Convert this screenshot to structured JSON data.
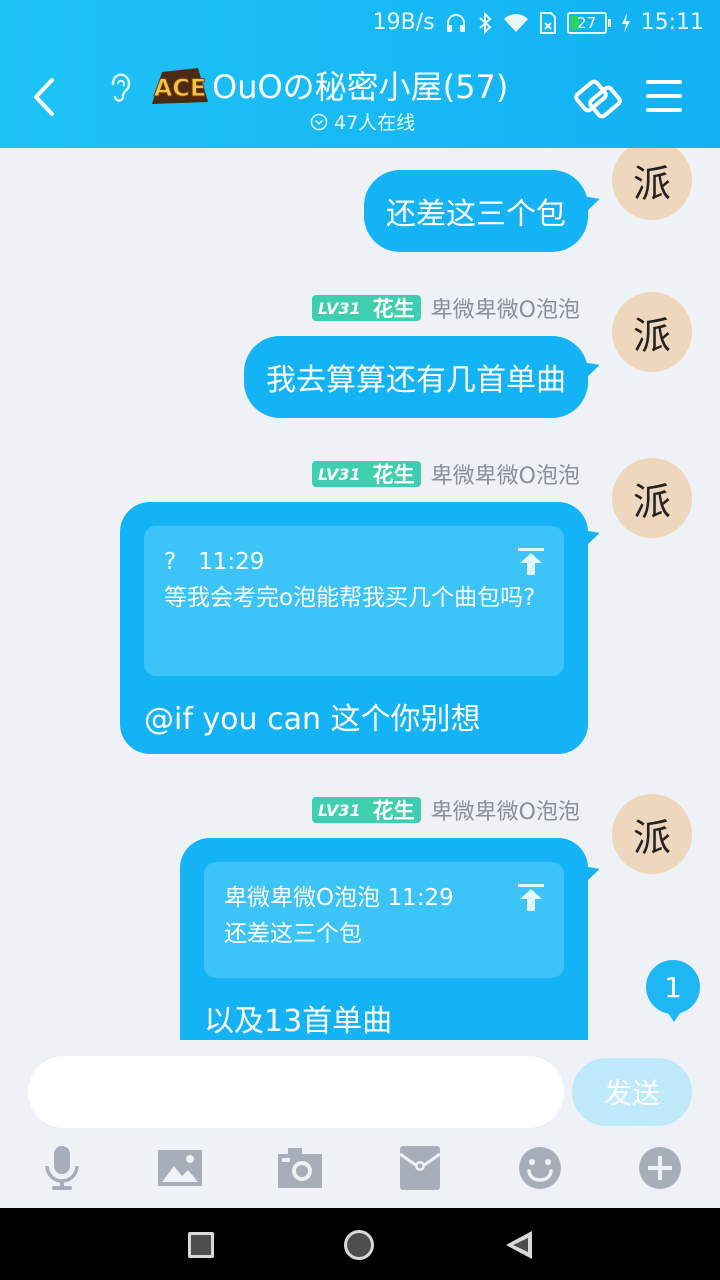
{
  "status_bar": {
    "speed": "19B/s",
    "battery": "27",
    "time": "15:11"
  },
  "header": {
    "title": "OuOの秘密小屋(57)",
    "online": "47人在线",
    "logo_text": "ACE"
  },
  "messages": [
    {
      "sender": {
        "level": "LV31",
        "title": "花生",
        "name": "卑微卑微O泡泡"
      },
      "text": "还差这三个包"
    },
    {
      "sender": {
        "level": "LV31",
        "title": "花生",
        "name": "卑微卑微O泡泡"
      },
      "text": "我去算算还有几首单曲"
    },
    {
      "sender": {
        "level": "LV31",
        "title": "花生",
        "name": "卑微卑微O泡泡"
      },
      "quote": {
        "author": "?",
        "time": "11:29",
        "text": "等我会考完o泡能帮我买几个曲包吗?"
      },
      "text": "@if you can 这个你别想"
    },
    {
      "sender": {
        "level": "LV31",
        "title": "花生",
        "name": "卑微卑微O泡泡"
      },
      "quote": {
        "author": "卑微卑微O泡泡",
        "time": "11:29",
        "text": "还差这三个包"
      },
      "text": "以及13首单曲"
    }
  ],
  "avatar_char": "派",
  "unread_count": "1",
  "input": {
    "placeholder": "",
    "send_label": "发送"
  },
  "toolbar": [
    "mic-icon",
    "image-icon",
    "camera-icon",
    "red-packet-icon",
    "emoji-icon",
    "plus-icon"
  ],
  "colors": {
    "header": "#1ec3f6",
    "bubble": "#14b3f5",
    "badge": "#3ecfb0",
    "avatar_bg": "#efd7bd"
  }
}
